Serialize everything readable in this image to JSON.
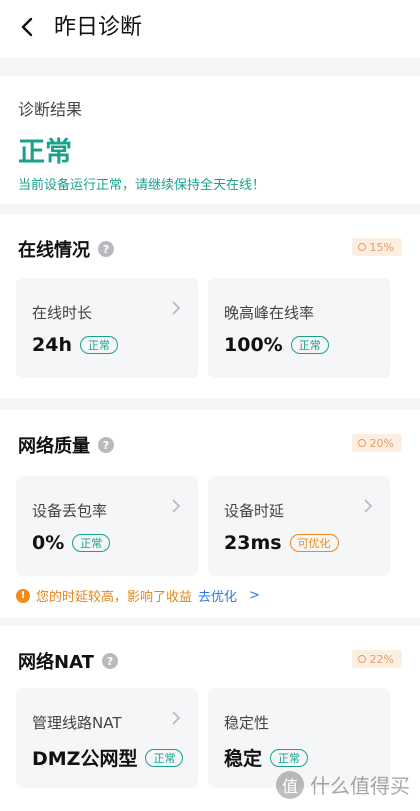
{
  "header": {
    "title": "昨日诊断"
  },
  "diagnosis": {
    "label": "诊断结果",
    "status": "正常",
    "description": "当前设备运行正常，请继续保持全天在线！"
  },
  "online": {
    "title": "在线情况",
    "percent": "15%",
    "tiles": [
      {
        "label": "在线时长",
        "value": "24h",
        "badge": "正常"
      },
      {
        "label": "晚高峰在线率",
        "value": "100%",
        "badge": "正常"
      }
    ]
  },
  "network": {
    "title": "网络质量",
    "percent": "20%",
    "tiles": [
      {
        "label": "设备丢包率",
        "value": "0%",
        "badge": "正常"
      },
      {
        "label": "设备时延",
        "value": "23ms",
        "badge": "可优化"
      }
    ],
    "notice": {
      "text": "您的时延较高，影响了收益",
      "link": "去优化",
      "arrow": ">"
    }
  },
  "nat": {
    "title": "网络NAT",
    "percent": "22%",
    "tiles": [
      {
        "label": "管理线路NAT",
        "value": "DMZ公网型",
        "badge": "正常"
      },
      {
        "label": "稳定性",
        "value": "稳定",
        "badge": "正常"
      }
    ]
  },
  "watermark": {
    "text": "什么值得买",
    "glyph": "值"
  },
  "colors": {
    "accent": "#1aa18e",
    "warning": "#f08a1c",
    "link": "#2a7ae2"
  }
}
